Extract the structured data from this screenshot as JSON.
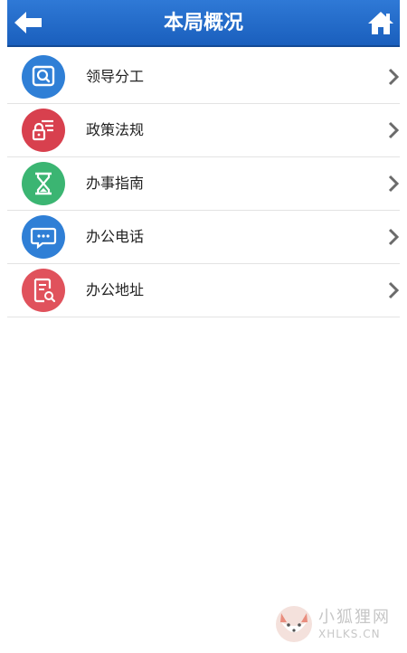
{
  "header": {
    "title": "本局概况",
    "back_icon": "arrow-left-icon",
    "home_icon": "home-icon",
    "bg_color": "#2267c8"
  },
  "menu": {
    "items": [
      {
        "label": "领导分工",
        "icon": "search-doc-icon",
        "color": "#2f7fd6"
      },
      {
        "label": "政策法规",
        "icon": "lock-doc-icon",
        "color": "#d8404e"
      },
      {
        "label": "办事指南",
        "icon": "hourglass-icon",
        "color": "#3bb572"
      },
      {
        "label": "办公电话",
        "icon": "chat-bubble-icon",
        "color": "#2f7fd6"
      },
      {
        "label": "办公地址",
        "icon": "doc-search-icon",
        "color": "#e0525c"
      }
    ]
  },
  "watermark": {
    "cn": "小狐狸网",
    "en": "XHLKS.CN"
  }
}
